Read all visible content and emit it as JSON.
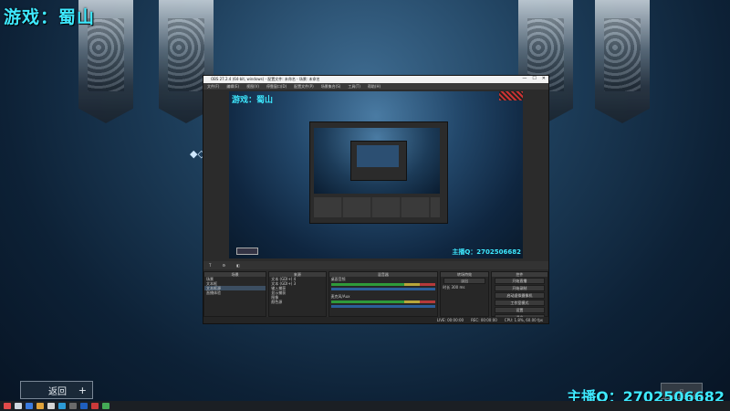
{
  "overlay": {
    "game_title": "游戏：蜀山",
    "streamer_qq": "主播Q：2702506682",
    "back_button": "返回",
    "back_plus": "+"
  },
  "obs": {
    "title": "OBS 27.2.4 (64-bit, windows) - 配置文件: 未命名 - 场景: 未命名",
    "menu": [
      "文件(F)",
      "编辑(E)",
      "视图(V)",
      "停靠窗口(D)",
      "配置文件(P)",
      "场景集合(S)",
      "工具(T)",
      "帮助(H)"
    ],
    "preview_title": "游戏：蜀山",
    "preview_qq": "主播Q：2702506682",
    "docks": {
      "scenes": "场景",
      "sources": "来源",
      "mixer": "混音器",
      "transitions": "转场特效",
      "controls": "控件"
    },
    "scene_items": [
      "场景",
      "文本框",
      "文本框源",
      "直播体验"
    ],
    "source_items": [
      "文本 (GDI+) 4",
      "文本 (GDI+) 3",
      "输入捕获",
      "显示捕获",
      "图像",
      "颜色源"
    ],
    "mixer_items": [
      "桌面音频",
      "麦克风/Aux"
    ],
    "transition": {
      "type": "淡出",
      "duration_label": "时长",
      "duration": "300 ms"
    },
    "controls": [
      "开始直播",
      "开始录制",
      "启动虚拟摄像机",
      "工作室模式",
      "设置",
      "退出"
    ],
    "status": {
      "live": "LIVE: 00:00:00",
      "rec": "REC: 00:00:00",
      "cpu": "CPU: 1.8%, 60.00 fps"
    }
  },
  "colors": {
    "accent_cyan": "#3ee9ff"
  }
}
